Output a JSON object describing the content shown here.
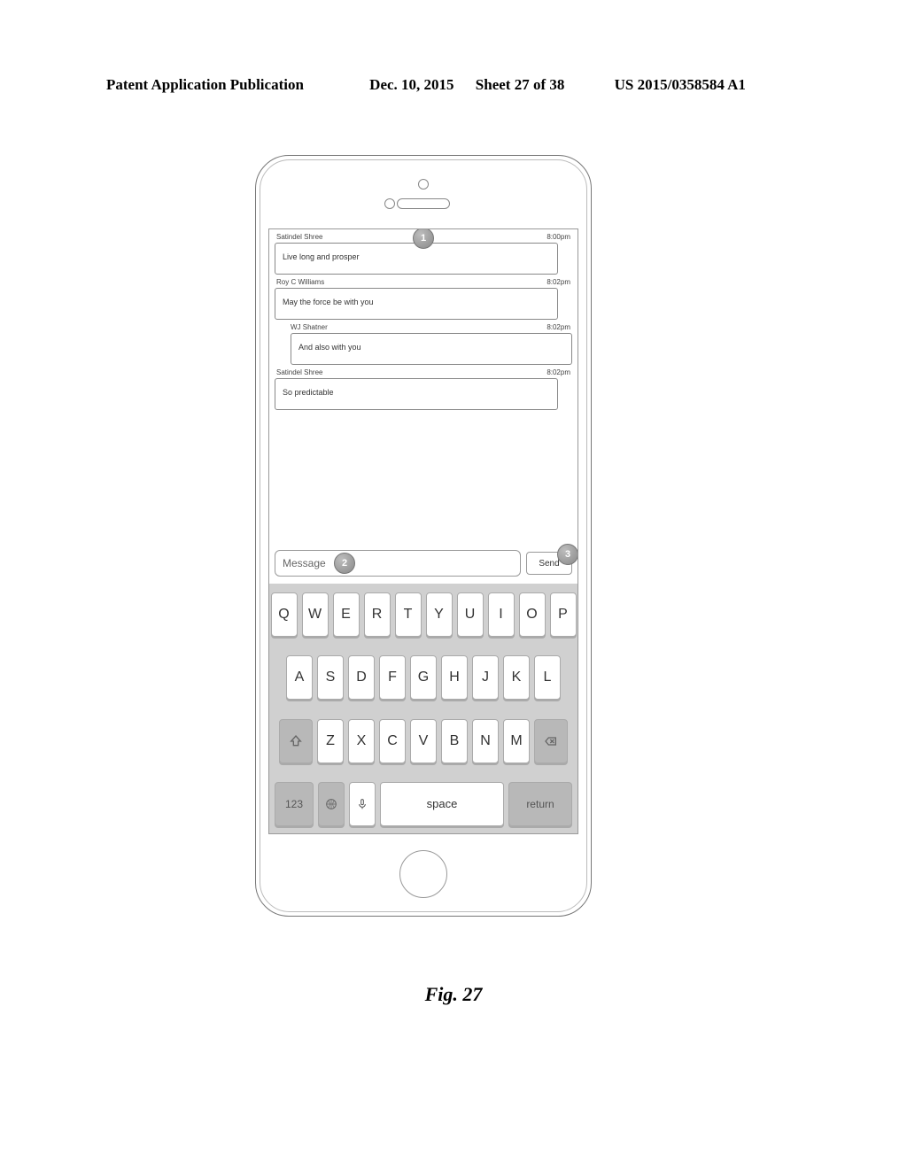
{
  "header": {
    "left": "Patent Application Publication",
    "date": "Dec. 10, 2015",
    "sheet": "Sheet 27 of 38",
    "pubno": "US 2015/0358584 A1"
  },
  "figure_caption": "Fig. 27",
  "badges": {
    "b1": "1",
    "b2": "2",
    "b3": "3"
  },
  "messages": [
    {
      "sender": "Satindel Shree",
      "time": "8:00pm",
      "text": "Live long and prosper",
      "side": "left"
    },
    {
      "sender": "Roy C Williams",
      "time": "8:02pm",
      "text": "May the force be with you",
      "side": "left"
    },
    {
      "sender": "WJ Shatner",
      "time": "8:02pm",
      "text": "And also with you",
      "side": "right"
    },
    {
      "sender": "Satindel Shree",
      "time": "8:02pm",
      "text": "So predictable",
      "side": "left"
    }
  ],
  "compose": {
    "placeholder": "Message",
    "send": "Send"
  },
  "keyboard": {
    "row1": [
      "Q",
      "W",
      "E",
      "R",
      "T",
      "Y",
      "U",
      "I",
      "O",
      "P"
    ],
    "row2": [
      "A",
      "S",
      "D",
      "F",
      "G",
      "H",
      "J",
      "K",
      "L"
    ],
    "row3": [
      "Z",
      "X",
      "C",
      "V",
      "B",
      "N",
      "M"
    ],
    "bottom": {
      "nums": "123",
      "space": "space",
      "return": "return"
    }
  }
}
